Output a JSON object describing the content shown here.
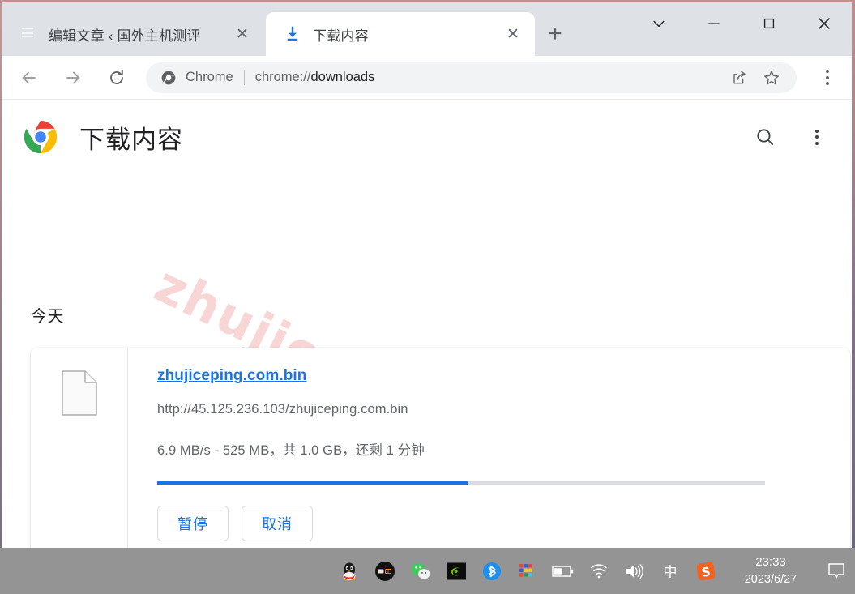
{
  "window": {
    "controls": {
      "tab_search_label": "∨",
      "minimize_label": "—",
      "maximize_label": "□",
      "close_label": "✕"
    }
  },
  "tabs": [
    {
      "title": "编辑文章 ‹ 国外主机测评",
      "favicon": "red-square-favicon",
      "close_label": "✕",
      "active": false
    },
    {
      "title": "下载内容",
      "favicon": "download-icon",
      "close_label": "✕",
      "active": true
    }
  ],
  "new_tab_label": "+",
  "toolbar": {
    "back_icon": "arrow-left-icon",
    "forward_icon": "arrow-right-icon",
    "reload_icon": "reload-icon",
    "omnibox": {
      "chip_label": "Chrome",
      "url_scheme": "chrome://",
      "url_host": "downloads",
      "full_url": "chrome://downloads"
    },
    "share_icon": "share-icon",
    "bookmark_icon": "star-icon",
    "menu_icon": "three-dots-icon"
  },
  "page": {
    "title": "下载内容",
    "logo": "chrome-logo",
    "search_icon": "search-icon",
    "menu_icon": "three-dots-icon",
    "watermark": "zhujiceping.com",
    "section_label": "今天",
    "download": {
      "file_icon": "generic-file-icon",
      "filename": "zhujiceping.com.bin",
      "url": "http://45.125.236.103/zhujiceping.com.bin",
      "status": "6.9 MB/s - 525 MB，共 1.0 GB，还剩 1 分钟",
      "speed": "6.9 MB/s",
      "downloaded": "525 MB",
      "total_size": "1.0 GB",
      "time_remaining": "1 分钟",
      "progress_percent": 51,
      "accent_color": "#1a73e8",
      "pause_label": "暂停",
      "cancel_label": "取消"
    }
  },
  "taskbar": {
    "tray": [
      {
        "name": "qq-icon"
      },
      {
        "name": "app-dark-circle-icon"
      },
      {
        "name": "wechat-icon"
      },
      {
        "name": "nvidia-icon"
      },
      {
        "name": "bluetooth-icon"
      },
      {
        "name": "color-grid-icon"
      },
      {
        "name": "battery-icon"
      },
      {
        "name": "wifi-icon"
      },
      {
        "name": "volume-icon"
      },
      {
        "name": "ime-icon",
        "label": "中"
      },
      {
        "name": "sogou-icon",
        "label": "S"
      }
    ],
    "time": "23:33",
    "date": "2023/6/27",
    "notification_icon": "notification-icon"
  }
}
